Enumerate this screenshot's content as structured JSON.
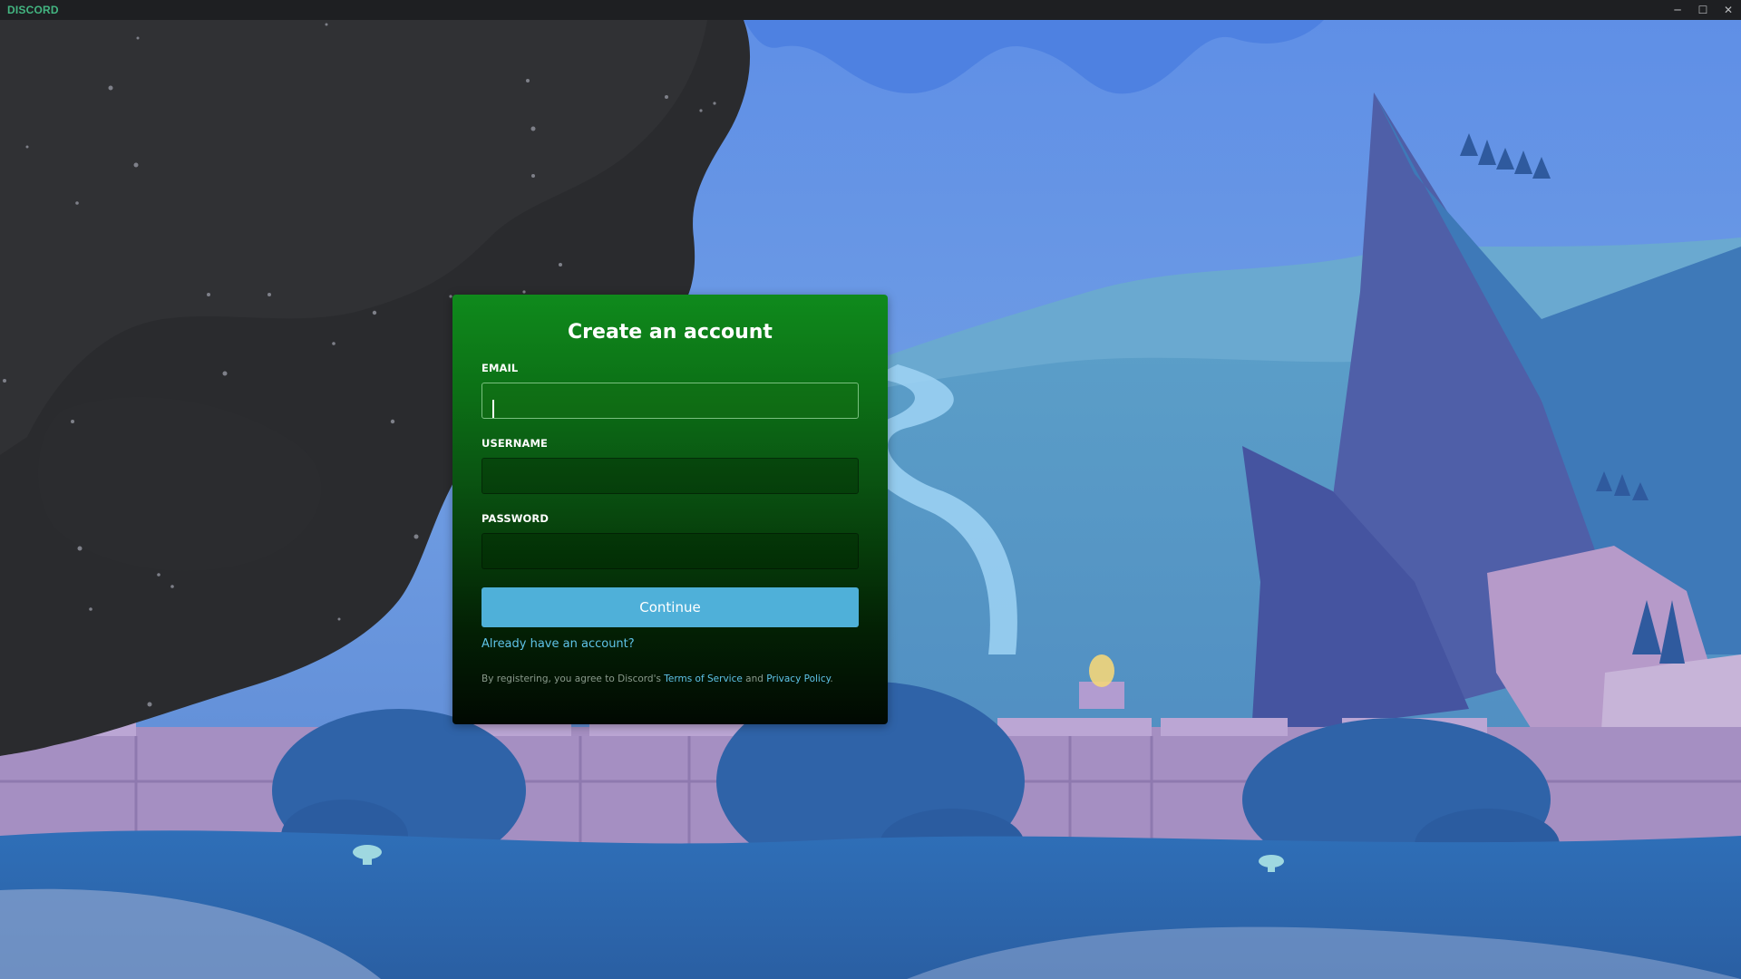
{
  "titlebar": {
    "brand": "DISCORD",
    "minimize_glyph": "─",
    "maximize_glyph": "☐",
    "close_glyph": "✕"
  },
  "modal": {
    "title": "Create an account",
    "fields": [
      {
        "label": "EMAIL",
        "value": "",
        "placeholder": ""
      },
      {
        "label": "USERNAME",
        "value": "",
        "placeholder": ""
      },
      {
        "label": "PASSWORD",
        "value": "",
        "placeholder": ""
      }
    ],
    "continue_label": "Continue",
    "login_link": "Already have an account?",
    "legal": {
      "prefix": "By registering, you agree to Discord's",
      "tos": "Terms of Service",
      "and": "and",
      "privacy": "Privacy Policy",
      "suffix": "."
    }
  },
  "colors": {
    "brand_green": "#43b581",
    "modal_green": "#0f8a1c",
    "button_blue": "#4fb0d9",
    "link_blue": "#5fc3e8"
  },
  "icons": {
    "minimize": "minimize-icon",
    "maximize": "maximize-icon",
    "close": "close-icon"
  }
}
